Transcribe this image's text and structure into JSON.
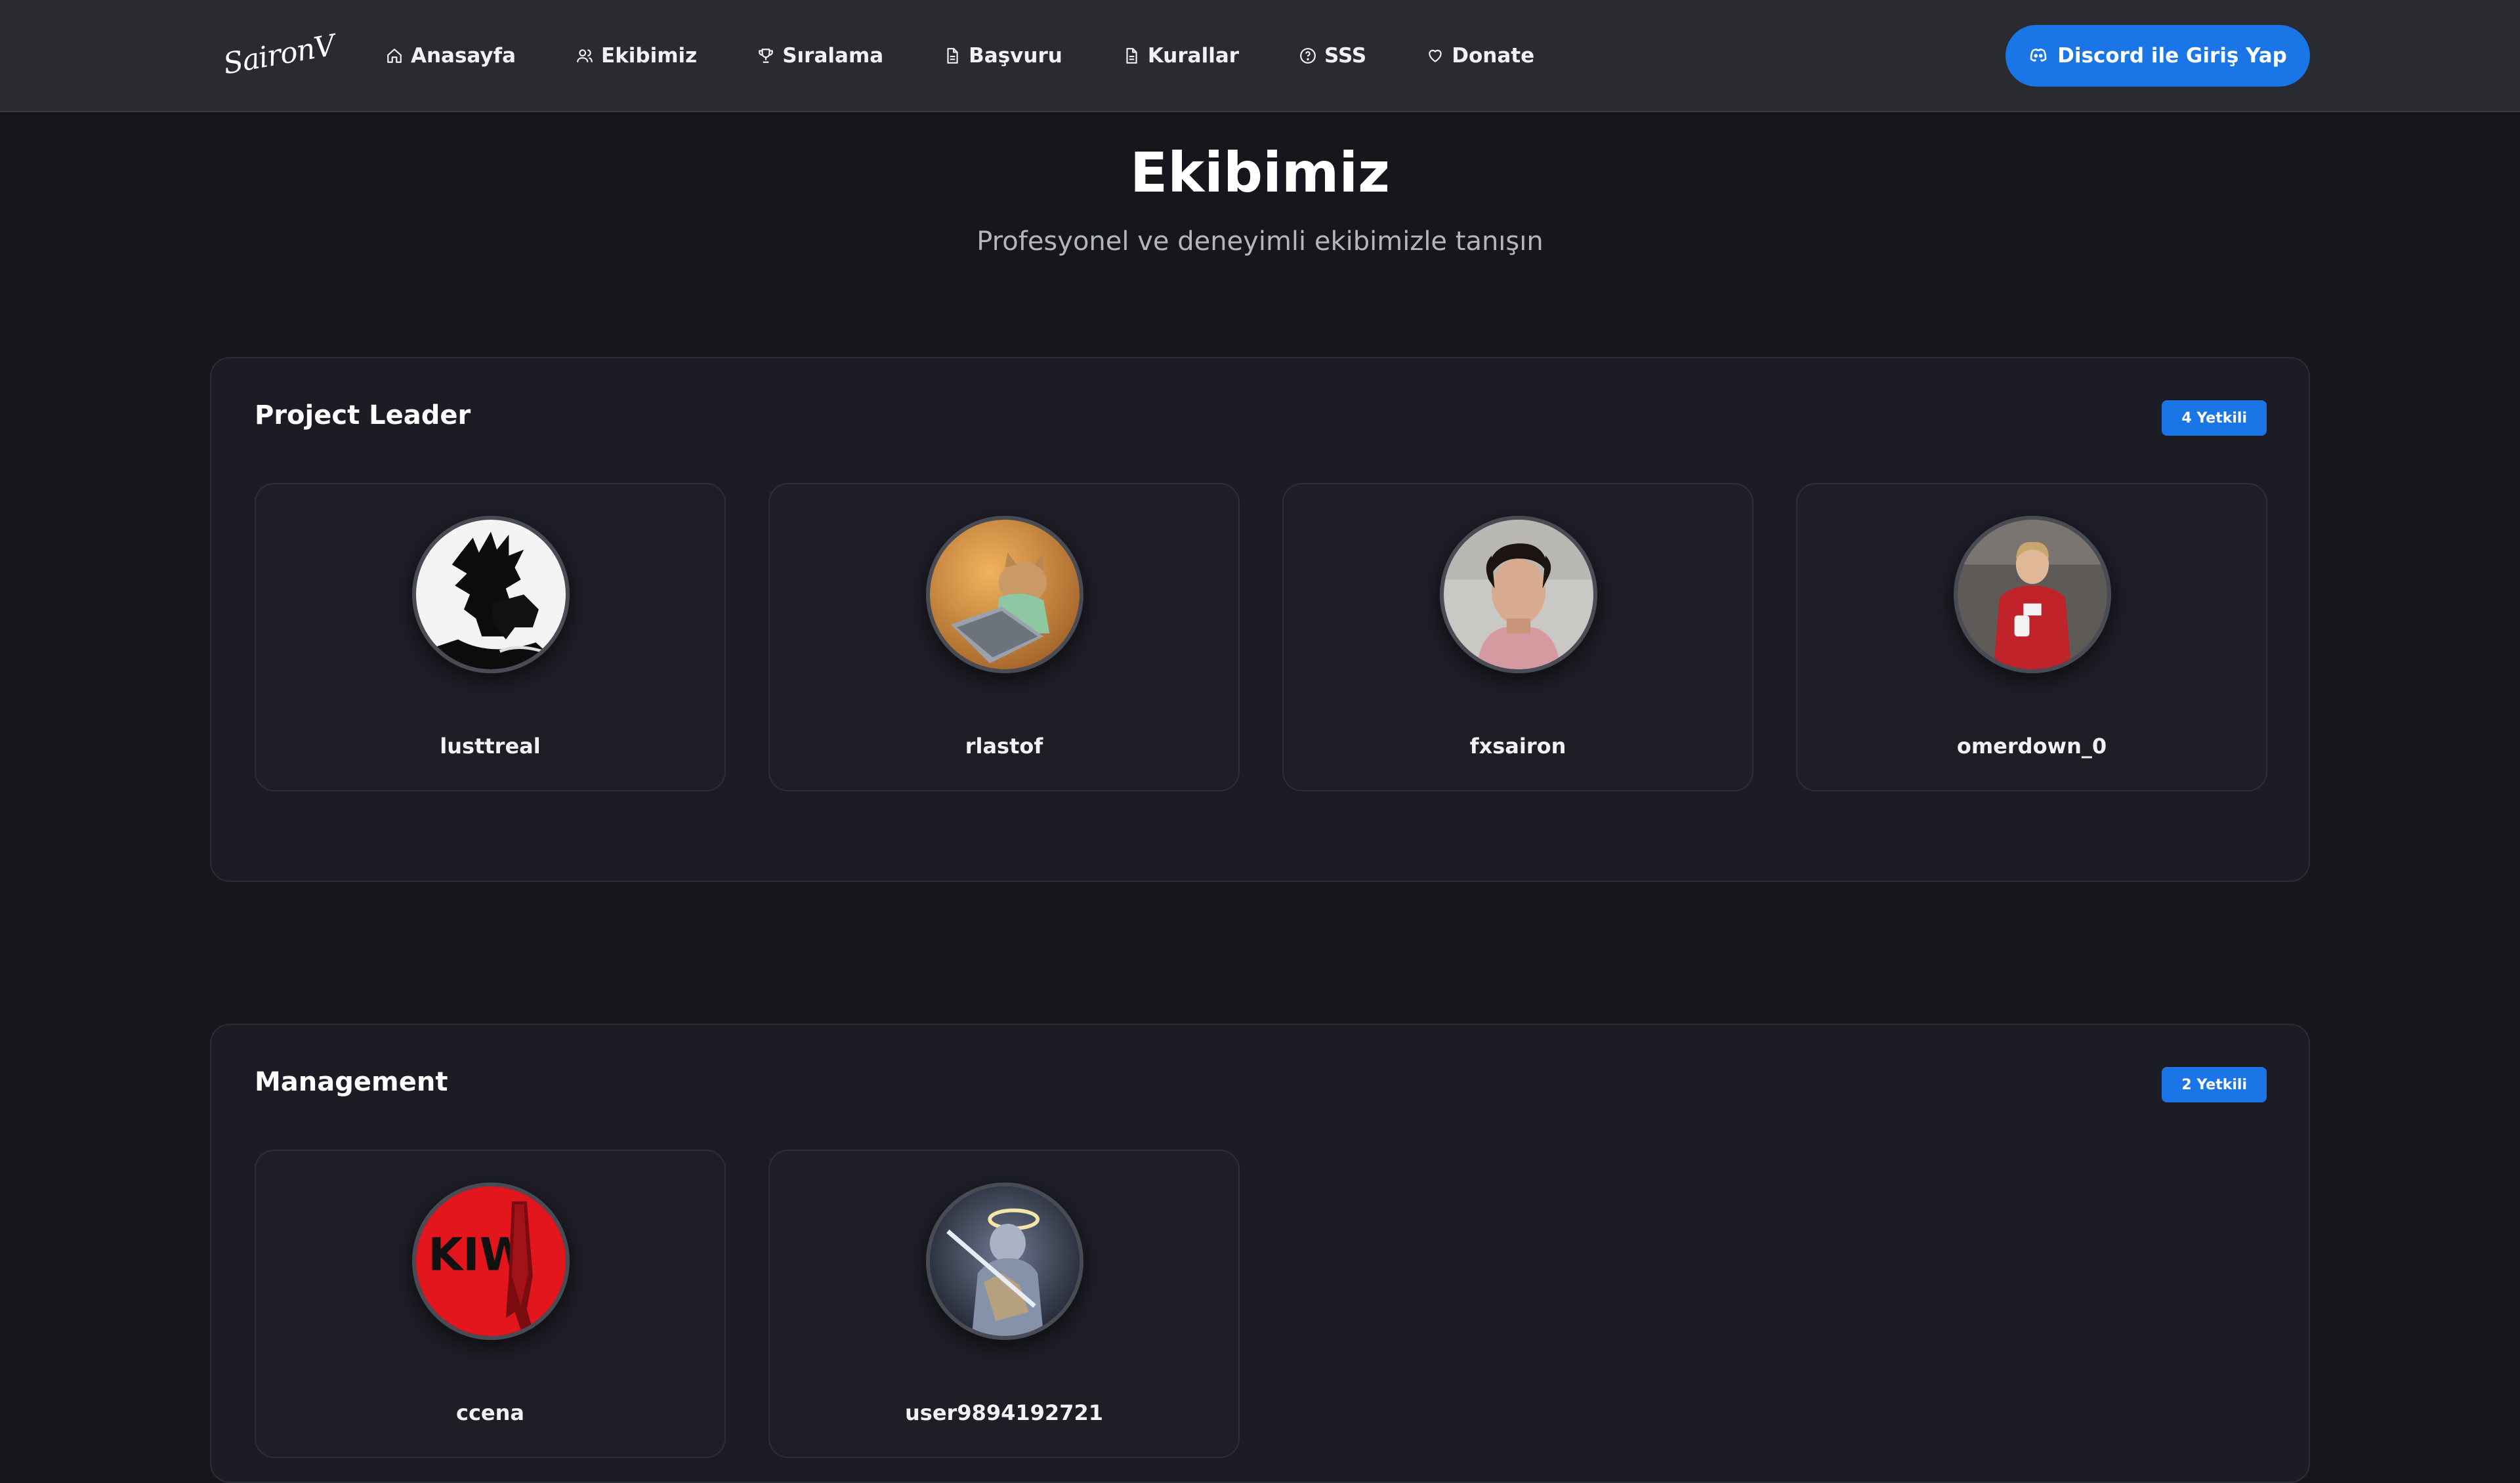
{
  "brand": {
    "logo_text": "SaironV"
  },
  "nav": {
    "items": [
      {
        "label": "Anasayfa",
        "icon": "home-icon"
      },
      {
        "label": "Ekibimiz",
        "icon": "users-icon"
      },
      {
        "label": "Sıralama",
        "icon": "trophy-icon"
      },
      {
        "label": "Başvuru",
        "icon": "document-icon"
      },
      {
        "label": "Kurallar",
        "icon": "document-icon"
      },
      {
        "label": "SSS",
        "icon": "help-circle-icon"
      },
      {
        "label": "Donate",
        "icon": "heart-icon"
      }
    ],
    "login_label": "Discord ile Giriş Yap",
    "login_icon": "discord-icon"
  },
  "hero": {
    "title": "Ekibimiz",
    "subtitle": "Profesyonel ve deneyimli ekibimizle tanışın"
  },
  "sections": [
    {
      "title": "Project Leader",
      "badge": "4 Yetkili",
      "members": [
        {
          "name": "lusttreal"
        },
        {
          "name": "rlastof"
        },
        {
          "name": "fxsairon"
        },
        {
          "name": "omerdown_0"
        }
      ]
    },
    {
      "title": "Management",
      "badge": "2 Yetkili",
      "members": [
        {
          "name": "ccena"
        },
        {
          "name": "user9894192721"
        }
      ]
    }
  ],
  "colors": {
    "accent": "#1a76e6",
    "background": "#16171c",
    "navbar": "#2a2b31",
    "card": "#1d1e26"
  }
}
